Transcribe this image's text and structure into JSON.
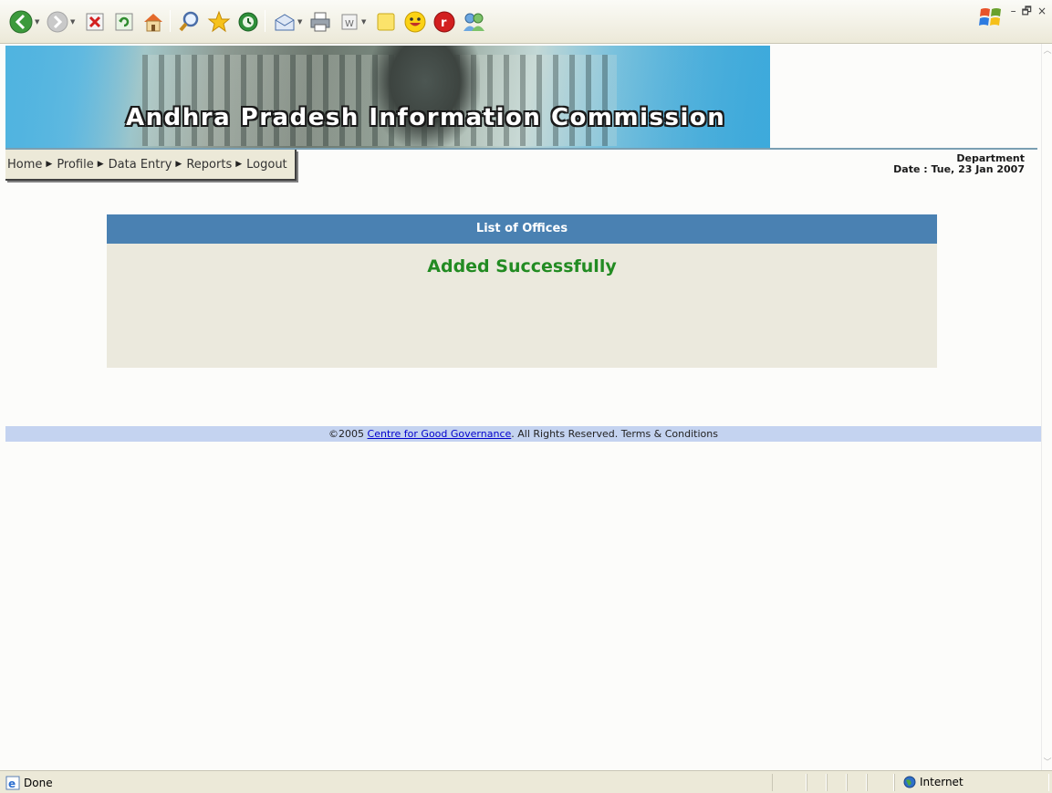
{
  "browser": {
    "toolbar_icons": [
      "back-icon",
      "forward-icon",
      "stop-icon",
      "refresh-icon",
      "home-icon",
      "search-icon",
      "favorites-icon",
      "history-icon",
      "mail-icon",
      "print-icon",
      "edit-icon",
      "notes-icon",
      "messenger-smiley-icon",
      "toolbar-red-button-icon",
      "contacts-icon"
    ],
    "status": {
      "text": "Done",
      "zone": "Internet"
    },
    "window_controls": {
      "minimize": "–",
      "restore": "🗗",
      "close": "×"
    }
  },
  "banner": {
    "title": "Andhra Pradesh Information Commission"
  },
  "menu": {
    "items": [
      {
        "label": "Home"
      },
      {
        "label": "Profile"
      },
      {
        "label": "Data Entry"
      },
      {
        "label": "Reports"
      },
      {
        "label": "Logout"
      }
    ]
  },
  "header_info": {
    "department": "Department",
    "date": "Date : Tue, 23 Jan 2007"
  },
  "panel": {
    "title": "List of Offices",
    "message": "Added Successfully"
  },
  "footer": {
    "prefix": "©2005 ",
    "link": "Centre for Good Governance",
    "suffix": ". All Rights Reserved. Terms & Conditions"
  },
  "colors": {
    "panel_header": "#4a81b2",
    "panel_body": "#ebe9dd",
    "success_text": "#228b22",
    "footer_bg": "#c4d3f0",
    "link": "#0000cc"
  }
}
